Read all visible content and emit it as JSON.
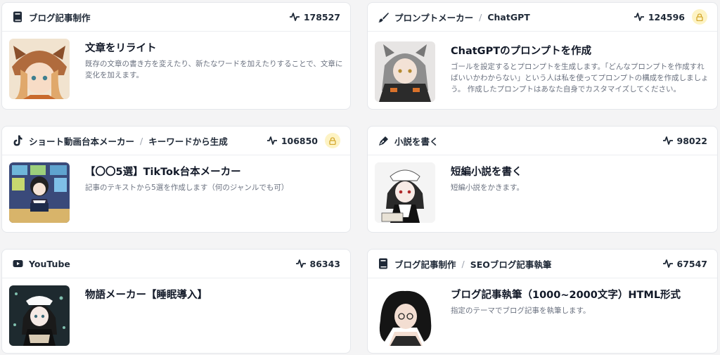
{
  "cards": [
    {
      "category": "ブログ記事制作",
      "subcategory": "",
      "views": "178527",
      "title": "文章をリライト",
      "description": "既存の文章の書き方を変えたり、新たなワードを加えたりすることで、文章に変化を加えます。"
    },
    {
      "category": "プロンプトメーカー",
      "subcategory": "ChatGPT",
      "views": "124596",
      "title": "ChatGPTのプロンプトを作成",
      "description": "ゴールを設定するとプロンプトを生成します。「どんなプロンプトを作成すればいいかわからない」という人は私を使ってプロンプトの構成を作成しましょう。 作成したプロンプトはあなた自身でカスタマイズしてください。"
    },
    {
      "category": "ショート動画台本メーカー",
      "subcategory": "キーワードから生成",
      "views": "106850",
      "title": "【〇〇5選】TikTok台本メーカー",
      "description": "記事のテキストから5選を作成します（何のジャンルでも可）"
    },
    {
      "category": "小説を書く",
      "subcategory": "",
      "views": "98022",
      "title": "短編小説を書く",
      "description": "短編小説をかきます。"
    },
    {
      "category": "YouTube",
      "subcategory": "",
      "views": "86343",
      "title": "物語メーカー【睡眠導入】",
      "description": ""
    },
    {
      "category": "ブログ記事制作",
      "subcategory": "SEOブログ記事執筆",
      "views": "67547",
      "title": "ブログ記事執筆（1000~2000文字）HTML形式",
      "description": "指定のテーマでブログ記事を執筆します。"
    }
  ],
  "separator": "/",
  "icons": {
    "blog": "book-icon",
    "prompt": "brush-icon",
    "tiktok": "tiktok-icon",
    "novel": "pen-icon",
    "youtube": "youtube-icon",
    "views": "activity-icon",
    "lock": "lock-icon"
  }
}
